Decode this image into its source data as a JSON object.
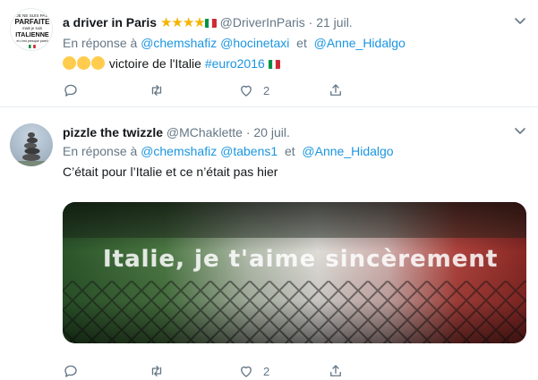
{
  "tweets": [
    {
      "display_name": "a driver in Paris",
      "stars": "★★★★",
      "handle": "@DriverInParis",
      "separator": "·",
      "date": "21 juil.",
      "reply_prefix": "En réponse à",
      "reply_mentions": [
        "@chemshafiz",
        "@hocinetaxi",
        "@Anne_Hidalgo"
      ],
      "reply_conjunction": "et",
      "text": "victoire de l'Italie",
      "hashtag": "#euro2016",
      "reply_count": "",
      "retweet_count": "",
      "like_count": "2",
      "avatar_text": [
        "JE NE SUIS PAS",
        "PARFAITE",
        "mais je suis",
        "ITALIENNE",
        "et c'est presque pareil"
      ]
    },
    {
      "display_name": "pizzle the twizzle",
      "handle": "@MChaklette",
      "separator": "·",
      "date": "20 juil.",
      "reply_prefix": "En réponse à",
      "reply_mentions": [
        "@chemshafiz",
        "@tabens1",
        "@Anne_Hidalgo"
      ],
      "reply_conjunction": "et",
      "text": "C’était pour l’Italie et ce n’était pas hier",
      "reply_count": "",
      "retweet_count": "",
      "like_count": "2",
      "media_caption": "Italie, je t'aime sincèrement"
    }
  ],
  "icons": {
    "reply": "reply-icon",
    "retweet": "retweet-icon",
    "like": "heart-icon",
    "share": "share-icon",
    "menu": "chevron-down-icon"
  },
  "colors": {
    "link": "#1b95e0",
    "secondary_text": "#657786",
    "star": "#f5b301",
    "flag_green": "#009246",
    "flag_white": "#ffffff",
    "flag_red": "#ce2b37"
  }
}
